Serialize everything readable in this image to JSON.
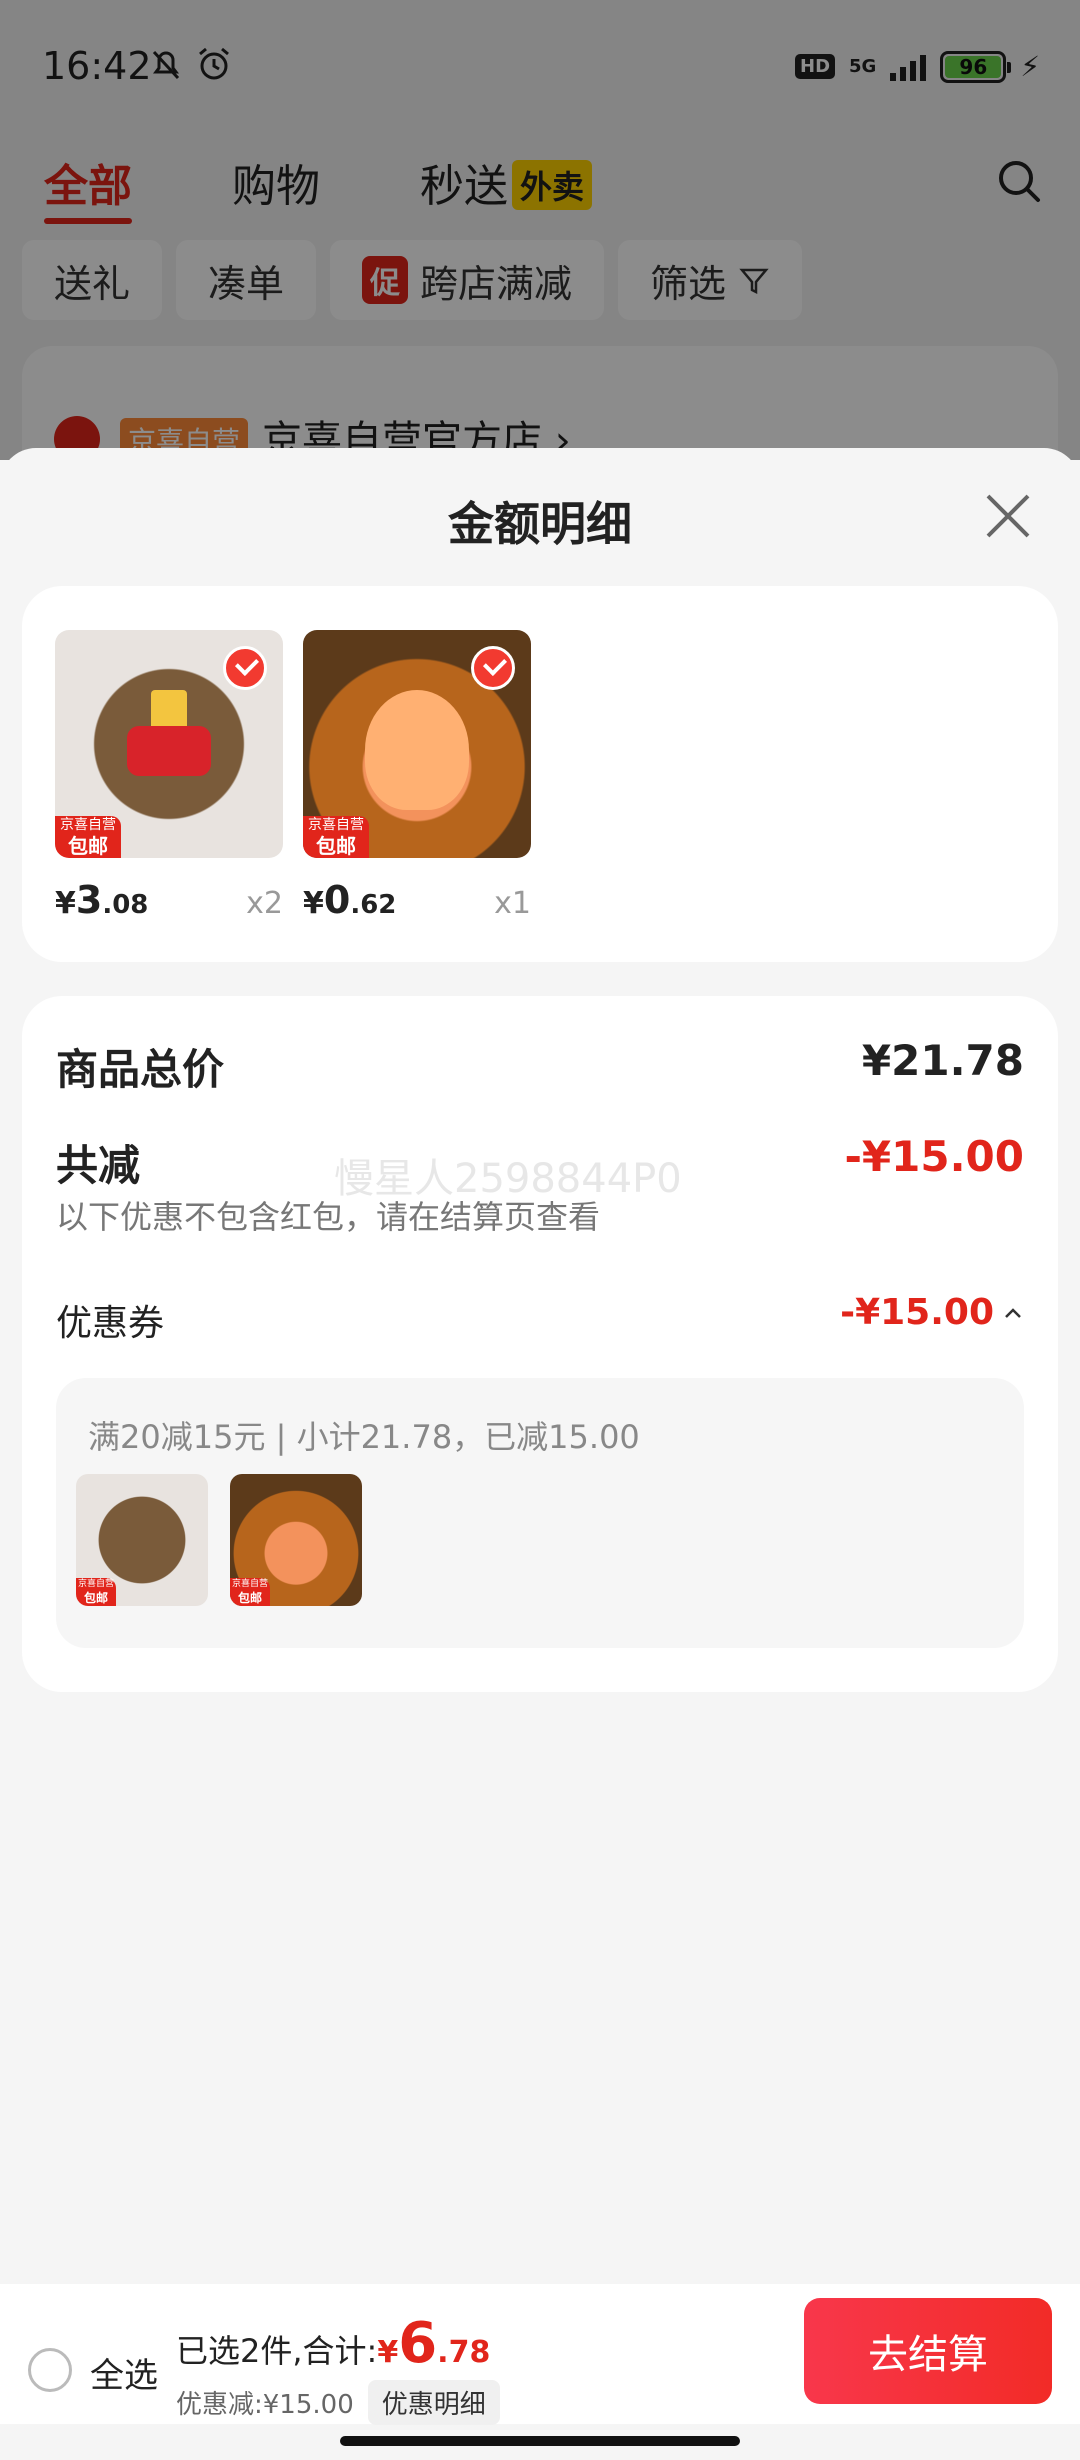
{
  "status_bar": {
    "time": "16:42",
    "network": "5G",
    "hd": "HD",
    "battery": "96"
  },
  "top_tabs": [
    {
      "label": "全部"
    },
    {
      "label": "购物"
    },
    {
      "label": "秒送"
    }
  ],
  "waimai_badge": "外卖",
  "filters": {
    "gift": "送礼",
    "combine": "凑单",
    "promo_tag": "促",
    "cross_store": "跨店满减",
    "filter": "筛选"
  },
  "store": {
    "tag": "京喜自营",
    "name": "京喜自营官方店 ›"
  },
  "sheet": {
    "title": "金额明细",
    "ship_tag_top": "京喜自营",
    "ship_tag_bottom": "包邮",
    "products": [
      {
        "price_currency": "¥",
        "price_int": "3",
        "price_dec": ".08",
        "qty": "x2"
      },
      {
        "price_currency": "¥",
        "price_int": "0",
        "price_dec": ".62",
        "qty": "x1"
      }
    ],
    "summary": {
      "total_label": "商品总价",
      "total_value": "¥21.78",
      "reduce_label": "共减",
      "reduce_value": "-¥15.00",
      "watermark": "慢星人2598844P0",
      "note": "以下优惠不包含红包，请在结算页查看",
      "coupon_label": "优惠券",
      "coupon_value": "-¥15.00",
      "coupon_desc": "满20减15元 | 小计21.78，已减15.00"
    }
  },
  "bottom_bar": {
    "select_all": "全选",
    "selected_text": "已选2件,合计:",
    "total_currency": "¥",
    "total_int": "6",
    "total_dec": ".78",
    "discount_text": "优惠减:¥15.00",
    "detail_button": "优惠明细",
    "checkout_button": "去结算"
  },
  "colors": {
    "accent": "#e1251b",
    "checkout": "#f22b27"
  }
}
